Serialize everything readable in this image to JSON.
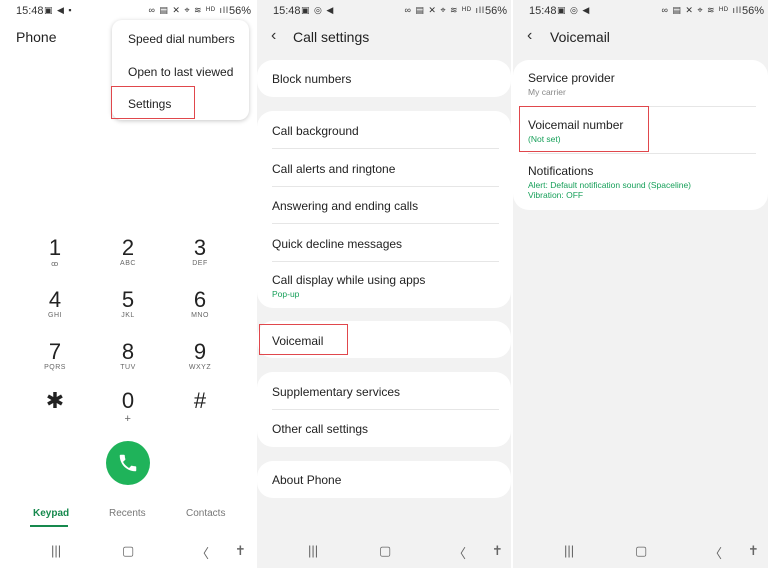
{
  "status": {
    "time": "15:48",
    "battery": "56%"
  },
  "phone": {
    "title": "Phone",
    "menu": [
      "Speed dial numbers",
      "Open to last viewed",
      "Settings"
    ],
    "keys": [
      {
        "d": "1",
        "l": "ꝏ"
      },
      {
        "d": "2",
        "l": "ABC"
      },
      {
        "d": "3",
        "l": "DEF"
      },
      {
        "d": "4",
        "l": "GHI"
      },
      {
        "d": "5",
        "l": "JKL"
      },
      {
        "d": "6",
        "l": "MNO"
      },
      {
        "d": "7",
        "l": "PQRS"
      },
      {
        "d": "8",
        "l": "TUV"
      },
      {
        "d": "9",
        "l": "WXYZ"
      },
      {
        "d": "✱",
        "l": ""
      },
      {
        "d": "0",
        "l": "+"
      },
      {
        "d": "#",
        "l": ""
      }
    ],
    "tabs": [
      "Keypad",
      "Recents",
      "Contacts"
    ]
  },
  "call_settings": {
    "title": "Call settings",
    "block": "Block numbers",
    "group2": [
      "Call background",
      "Call alerts and ringtone",
      "Answering and ending calls",
      "Quick decline messages",
      "Call display while using apps"
    ],
    "group2_sub": "Pop-up",
    "voicemail": "Voicemail",
    "group4": [
      "Supplementary services",
      "Other call settings"
    ],
    "about": "About Phone"
  },
  "voicemail": {
    "title": "Voicemail",
    "provider": "Service provider",
    "provider_sub": "My carrier",
    "number": "Voicemail number",
    "number_sub": "(Not set)",
    "notifications": "Notifications",
    "notif_sub1": "Alert: Default notification sound (Spaceline)",
    "notif_sub2": "Vibration: OFF"
  }
}
